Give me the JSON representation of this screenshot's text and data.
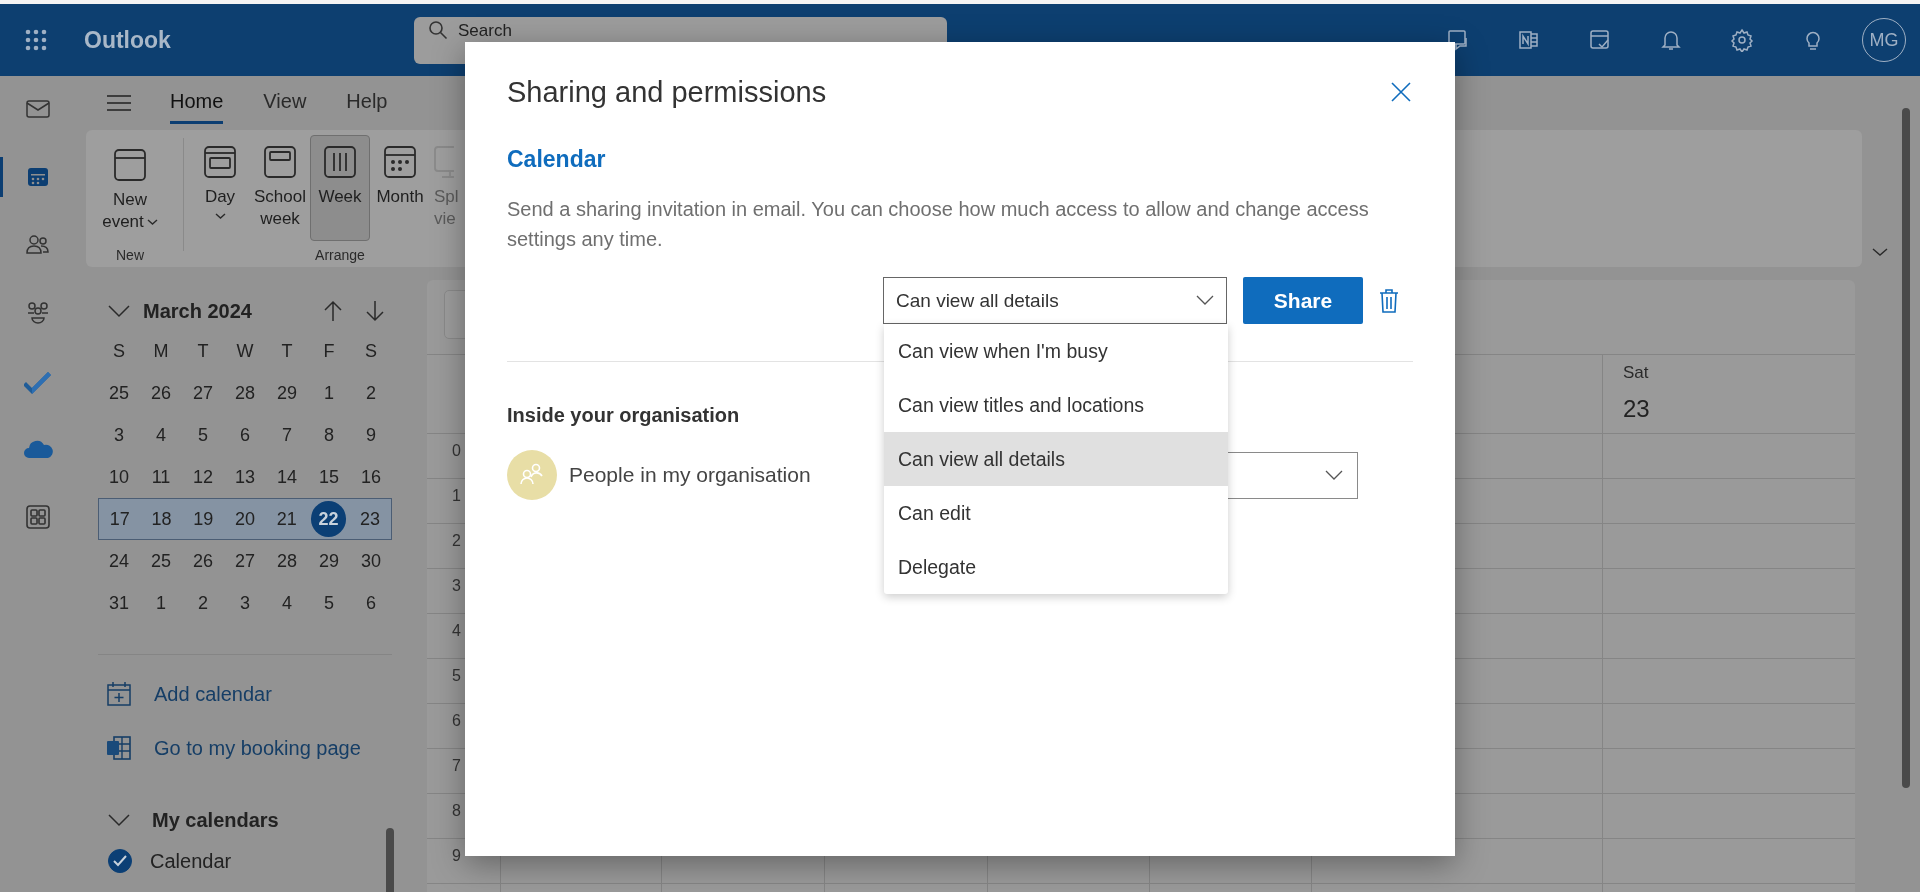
{
  "top_bar": {
    "app_name": "Outlook",
    "search": {
      "placeholder": "Search"
    },
    "avatar": "MG"
  },
  "rail": [
    {
      "kind": "mail",
      "selected": false
    },
    {
      "kind": "calendar",
      "selected": true
    },
    {
      "kind": "people",
      "selected": false
    },
    {
      "kind": "groups",
      "selected": false
    },
    {
      "kind": "todo",
      "selected": false
    },
    {
      "kind": "cloud",
      "selected": false
    },
    {
      "kind": "apps",
      "selected": false
    }
  ],
  "tabs": [
    {
      "label": "Home",
      "selected": true
    },
    {
      "label": "View",
      "selected": false
    },
    {
      "label": "Help",
      "selected": false
    }
  ],
  "ribbon": {
    "groups": [
      {
        "label": "New",
        "buttons": [
          {
            "kind": "event",
            "lines": [
              "New",
              "event"
            ],
            "caret": true,
            "selected": false,
            "disabled": false
          }
        ]
      },
      {
        "label": "Arrange",
        "buttons": [
          {
            "kind": "day",
            "lines": [
              "Day"
            ],
            "caret": true,
            "selected": false,
            "disabled": false
          },
          {
            "kind": "workweek",
            "lines": [
              "School",
              "week"
            ],
            "caret": false,
            "selected": false,
            "disabled": false
          },
          {
            "kind": "week",
            "lines": [
              "Week"
            ],
            "caret": false,
            "selected": true,
            "disabled": false
          },
          {
            "kind": "month",
            "lines": [
              "Month"
            ],
            "caret": false,
            "selected": false,
            "disabled": false
          },
          {
            "kind": "split",
            "lines": [
              "Spl",
              "vie"
            ],
            "caret": false,
            "selected": false,
            "disabled": true
          }
        ]
      }
    ]
  },
  "mini_calendar": {
    "title": "March 2024",
    "weekdays": [
      "S",
      "M",
      "T",
      "W",
      "T",
      "F",
      "S"
    ],
    "weeks": [
      {
        "selected": false,
        "days": [
          {
            "label": "25",
            "today": false
          },
          {
            "label": "26",
            "today": false
          },
          {
            "label": "27",
            "today": false
          },
          {
            "label": "28",
            "today": false
          },
          {
            "label": "29",
            "today": false
          },
          {
            "label": "1",
            "today": false
          },
          {
            "label": "2",
            "today": false
          }
        ]
      },
      {
        "selected": false,
        "days": [
          {
            "label": "3",
            "today": false
          },
          {
            "label": "4",
            "today": false
          },
          {
            "label": "5",
            "today": false
          },
          {
            "label": "6",
            "today": false
          },
          {
            "label": "7",
            "today": false
          },
          {
            "label": "8",
            "today": false
          },
          {
            "label": "9",
            "today": false
          }
        ]
      },
      {
        "selected": false,
        "days": [
          {
            "label": "10",
            "today": false
          },
          {
            "label": "11",
            "today": false
          },
          {
            "label": "12",
            "today": false
          },
          {
            "label": "13",
            "today": false
          },
          {
            "label": "14",
            "today": false
          },
          {
            "label": "15",
            "today": false
          },
          {
            "label": "16",
            "today": false
          }
        ]
      },
      {
        "selected": true,
        "days": [
          {
            "label": "17",
            "today": false
          },
          {
            "label": "18",
            "today": false
          },
          {
            "label": "19",
            "today": false
          },
          {
            "label": "20",
            "today": false
          },
          {
            "label": "21",
            "today": false
          },
          {
            "label": "22",
            "today": true
          },
          {
            "label": "23",
            "today": false
          }
        ]
      },
      {
        "selected": false,
        "days": [
          {
            "label": "24",
            "today": false
          },
          {
            "label": "25",
            "today": false
          },
          {
            "label": "26",
            "today": false
          },
          {
            "label": "27",
            "today": false
          },
          {
            "label": "28",
            "today": false
          },
          {
            "label": "29",
            "today": false
          },
          {
            "label": "30",
            "today": false
          }
        ]
      },
      {
        "selected": false,
        "days": [
          {
            "label": "31",
            "today": false
          },
          {
            "label": "1",
            "today": false
          },
          {
            "label": "2",
            "today": false
          },
          {
            "label": "3",
            "today": false
          },
          {
            "label": "4",
            "today": false
          },
          {
            "label": "5",
            "today": false
          },
          {
            "label": "6",
            "today": false
          }
        ]
      }
    ]
  },
  "links": [
    {
      "kind": "add",
      "label": "Add calendar"
    },
    {
      "kind": "booking",
      "label": "Go to my booking page"
    }
  ],
  "my_calendars": {
    "title": "My calendars",
    "expanded": true,
    "items": [
      {
        "label": "Calendar",
        "checked": true
      }
    ]
  },
  "week_view": {
    "header": {
      "day": "Sat",
      "date": "23"
    },
    "hours": [
      "0",
      "1",
      "2",
      "3",
      "4",
      "5",
      "6",
      "7",
      "8",
      "9"
    ]
  },
  "dialog": {
    "title": "Sharing and permissions",
    "calendar": "Calendar",
    "description": "Send a sharing invitation in email. You can choose how much access to allow and change access settings any time.",
    "permission": {
      "value": "Can view all details",
      "expanded": true
    },
    "share_button": "Share",
    "options": [
      {
        "label": "Can view when I'm busy",
        "selected": false
      },
      {
        "label": "Can view titles and locations",
        "selected": false
      },
      {
        "label": "Can view all details",
        "selected": true
      },
      {
        "label": "Can edit",
        "selected": false
      },
      {
        "label": "Delegate",
        "selected": false
      }
    ],
    "org_heading": "Inside your organisation",
    "members": [
      {
        "name": "People in my organisation"
      }
    ]
  }
}
